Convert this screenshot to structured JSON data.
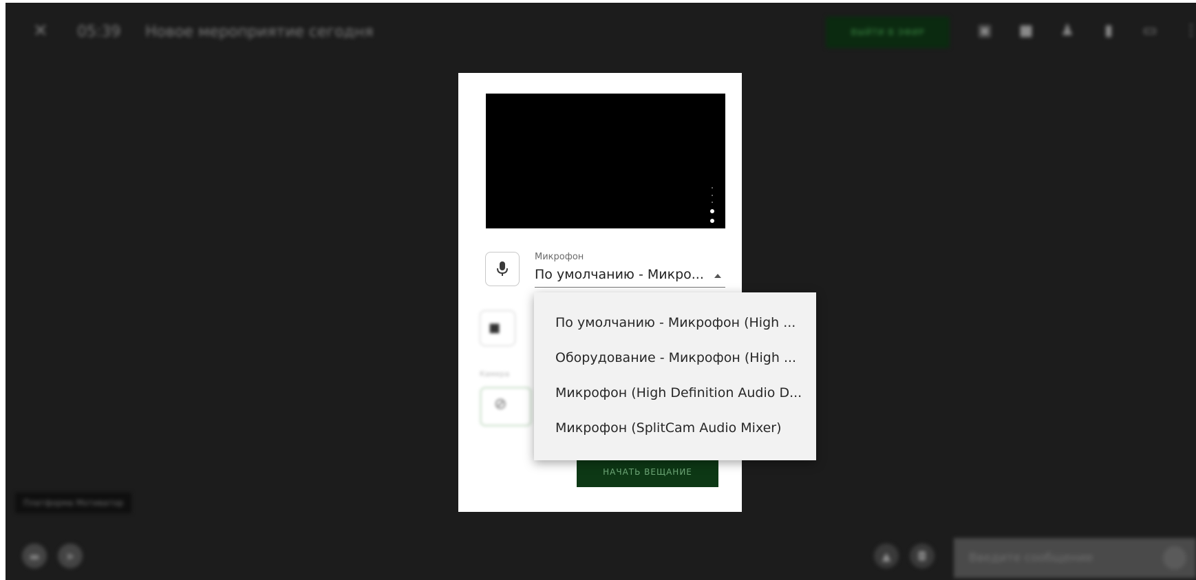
{
  "topbar": {
    "close_glyph": "✕",
    "time": "05:39",
    "title": "Новое мероприятие сегодня",
    "live_button": "ВЫЙТИ В ЭФИР"
  },
  "footer": {
    "platform_label": "Платформа Мотиватор",
    "message_placeholder": "Введите сообщение"
  },
  "modal": {
    "microphone_label": "Микрофон",
    "microphone_value": "По умолчанию - Микро...",
    "start_button": "НАЧАТЬ ВЕЩАНИЕ",
    "camera_section_label": "Камера"
  },
  "dropdown": {
    "options": [
      "По умолчанию - Микрофон (High ...",
      "Оборудование - Микрофон (High ...",
      "Микрофон (High Definition Audio D...",
      "Микрофон (SplitCam Audio Mixer)"
    ]
  },
  "colors": {
    "background": "#1c1c1c",
    "accent_green": "#0d3815",
    "dropdown_bg": "#f2f2f2"
  }
}
